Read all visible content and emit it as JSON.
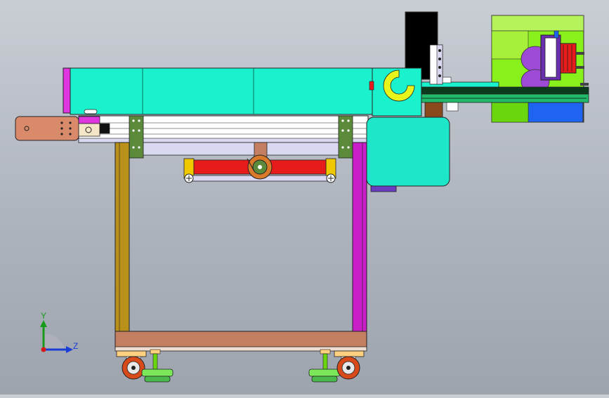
{
  "viewport": {
    "background_top": "#c9cdd4",
    "background_bottom": "#9ea4ae"
  },
  "triad": {
    "y_label": "Y",
    "z_label": "Z",
    "y_color": "#1a9a1a",
    "z_color": "#1a3dd6",
    "x_color": "#d11a1a"
  },
  "colors": {
    "cover": "#19f2cc",
    "cover_accent": "#e036e0",
    "frame_left": "#b8901a",
    "frame_right": "#c91fc9",
    "bed": "#c47f63",
    "roller": "#e81b1b",
    "clamp": "#f0c800",
    "motor_box": "#1ee6c8",
    "right_unit": "#88f01a",
    "right_unit_blue": "#1e64f0",
    "spheres": "#9d4ad6",
    "caster": "#d84a1a",
    "leveling_pad": "#7be85a",
    "tower": "#000000",
    "bracket": "#5a8a3a",
    "rail": "#d8d8f0"
  }
}
